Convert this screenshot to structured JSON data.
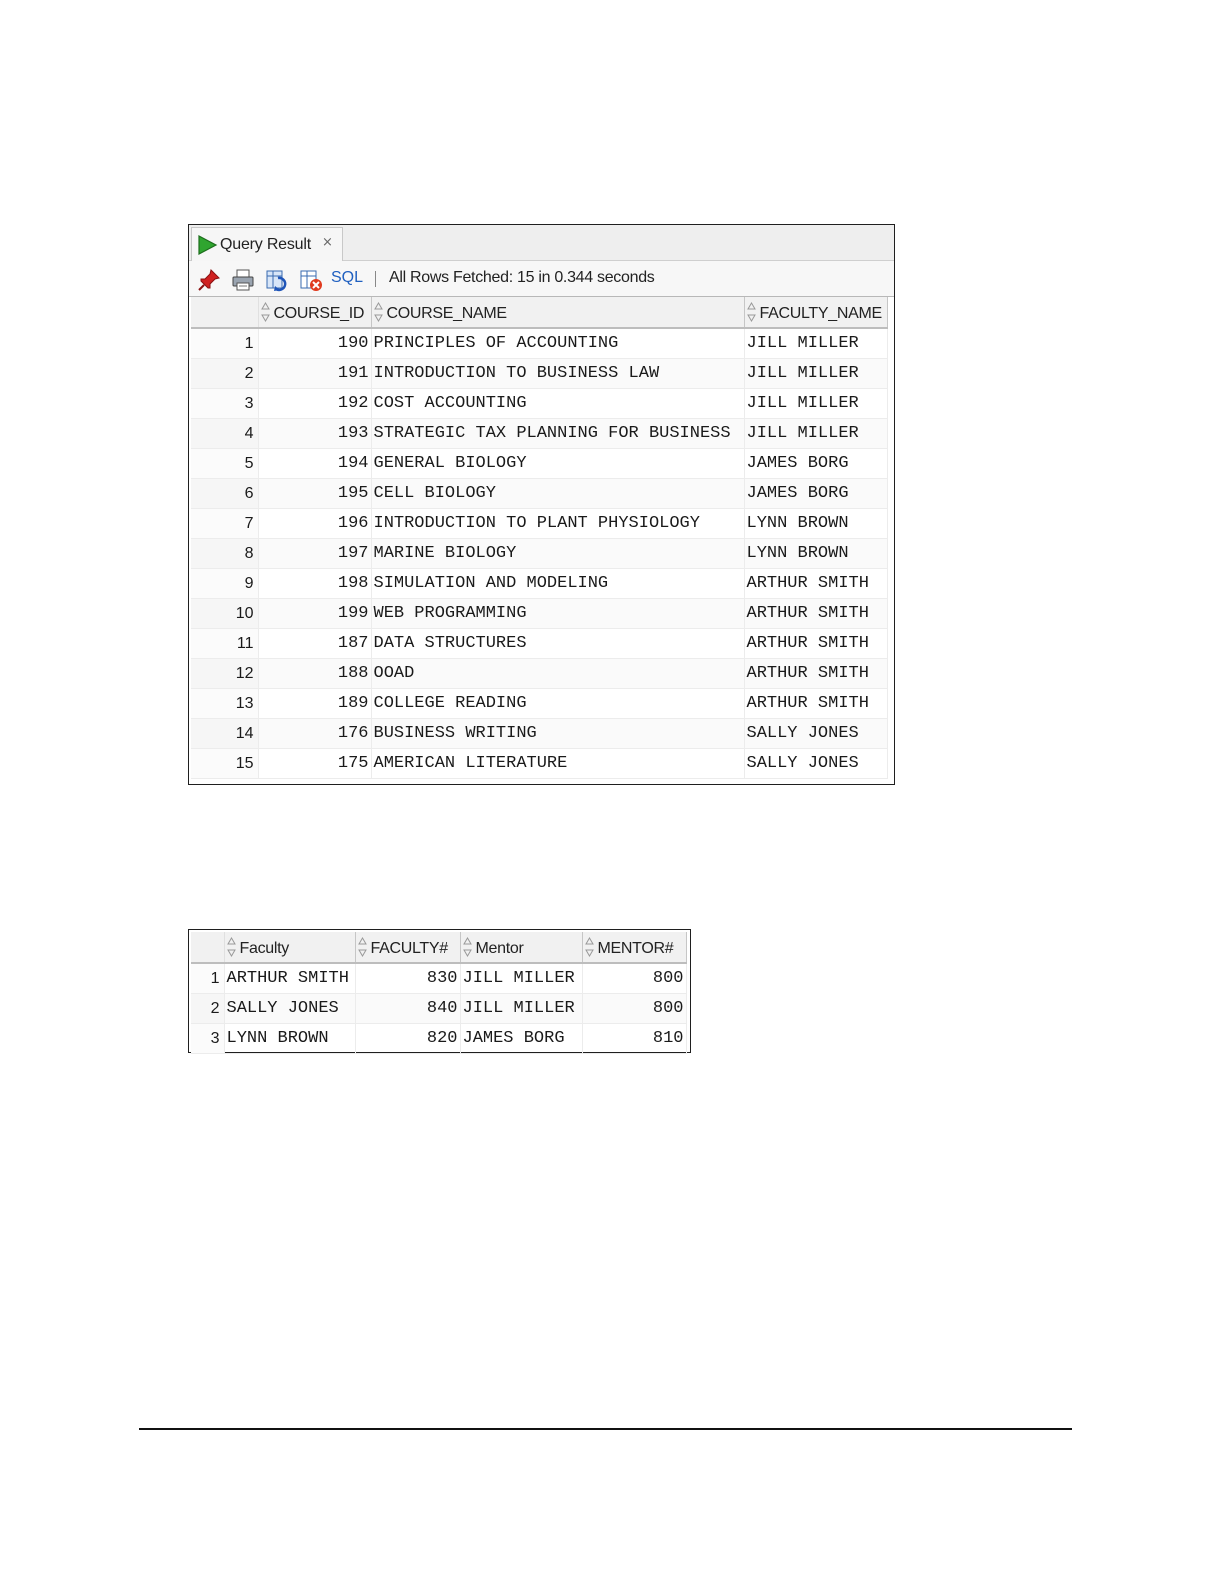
{
  "query_panel": {
    "tab_label": "Query Result",
    "tab_close": "×",
    "toolbar": {
      "sql_label": "SQL",
      "status": "All Rows Fetched: 15 in 0.344 seconds"
    },
    "columns": [
      "",
      "COURSE_ID",
      "COURSE_NAME",
      "FACULTY_NAME"
    ],
    "rows": [
      [
        "1",
        "190",
        "PRINCIPLES OF ACCOUNTING",
        "JILL MILLER"
      ],
      [
        "2",
        "191",
        "INTRODUCTION TO BUSINESS LAW",
        "JILL MILLER"
      ],
      [
        "3",
        "192",
        "COST ACCOUNTING",
        "JILL MILLER"
      ],
      [
        "4",
        "193",
        "STRATEGIC TAX PLANNING FOR BUSINESS",
        "JILL MILLER"
      ],
      [
        "5",
        "194",
        "GENERAL BIOLOGY",
        "JAMES BORG"
      ],
      [
        "6",
        "195",
        "CELL BIOLOGY",
        "JAMES BORG"
      ],
      [
        "7",
        "196",
        "INTRODUCTION TO PLANT PHYSIOLOGY",
        "LYNN BROWN"
      ],
      [
        "8",
        "197",
        "MARINE BIOLOGY",
        "LYNN BROWN"
      ],
      [
        "9",
        "198",
        "SIMULATION AND MODELING",
        "ARTHUR SMITH"
      ],
      [
        "10",
        "199",
        "WEB PROGRAMMING",
        "ARTHUR SMITH"
      ],
      [
        "11",
        "187",
        "DATA STRUCTURES",
        "ARTHUR SMITH"
      ],
      [
        "12",
        "188",
        "OOAD",
        "ARTHUR SMITH"
      ],
      [
        "13",
        "189",
        "COLLEGE READING",
        "ARTHUR SMITH"
      ],
      [
        "14",
        "176",
        "BUSINESS WRITING",
        "SALLY JONES"
      ],
      [
        "15",
        "175",
        "AMERICAN LITERATURE",
        "SALLY JONES"
      ]
    ]
  },
  "mentor_panel": {
    "columns": [
      "",
      "Faculty",
      "FACULTY#",
      "Mentor",
      "MENTOR#"
    ],
    "rows": [
      [
        "1",
        "ARTHUR SMITH",
        "830",
        "JILL MILLER",
        "800"
      ],
      [
        "2",
        "SALLY JONES",
        "840",
        "JILL MILLER",
        "800"
      ],
      [
        "3",
        "LYNN BROWN",
        "820",
        "JAMES BORG",
        "810"
      ]
    ]
  },
  "icons": {
    "run": "run-triangle-icon",
    "pin": "pin-icon",
    "print": "print-icon",
    "refresh": "refresh-icon",
    "freeze": "freeze-view-icon",
    "sort": "sort-icon"
  },
  "colors": {
    "run_green": "#2fa52f",
    "pin_red": "#d02020",
    "sql_link": "#2060c0"
  }
}
